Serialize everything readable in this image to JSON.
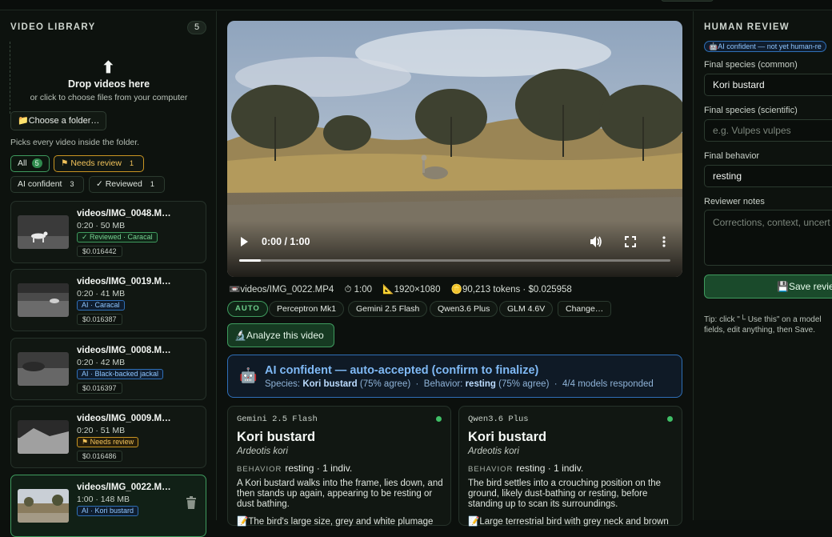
{
  "library": {
    "title": "VIDEO LIBRARY",
    "count": "5",
    "drop_title": "Drop videos here",
    "drop_sub": "or click to choose files from your computer",
    "choose_label": "📁Choose a folder…",
    "picks_note": "Picks every video inside the folder.",
    "filters": [
      {
        "label": "All",
        "count": "5"
      },
      {
        "label": "⚑ Needs review",
        "count": "1"
      },
      {
        "label": "AI confident",
        "count": "3"
      },
      {
        "label": "✓ Reviewed",
        "count": "1"
      }
    ],
    "videos": [
      {
        "name": "videos/IMG_0048.M…",
        "meta": "0:20 · 50 MB",
        "badge": "✓ Reviewed · Caracal",
        "badge_color": "green",
        "cost": "$0.016442"
      },
      {
        "name": "videos/IMG_0019.M…",
        "meta": "0:20 · 41 MB",
        "badge": "AI · Caracal",
        "badge_color": "blue",
        "cost": "$0.016387"
      },
      {
        "name": "videos/IMG_0008.M…",
        "meta": "0:20 · 42 MB",
        "badge": "AI · Black-backed jackal",
        "badge_color": "blue",
        "cost": "$0.016397"
      },
      {
        "name": "videos/IMG_0009.M…",
        "meta": "0:20 · 51 MB",
        "badge": "⚑ Needs review",
        "badge_color": "yellow",
        "cost": "$0.016486"
      },
      {
        "name": "videos/IMG_0022.M…",
        "meta": "1:00 · 148 MB",
        "badge": "AI · Kori bustard",
        "badge_color": "blue",
        "cost": ""
      }
    ]
  },
  "player": {
    "time": "0:00 / 1:00",
    "progress": 0.05
  },
  "meta": {
    "file": "📼videos/IMG_0022.MP4",
    "duration": "⏱ 1:00",
    "resolution": "📐1920×1080",
    "tokens": "🪙90,213 tokens · $0.025958"
  },
  "models": {
    "auto": "AUTO",
    "list": [
      "Perceptron Mk1",
      "Gemini 2.5 Flash",
      "Qwen3.6 Plus",
      "GLM 4.6V"
    ],
    "change": "Change…"
  },
  "analyze_label": "🔬Analyze this video",
  "verdict": {
    "icon": "🤖",
    "title": "AI confident — auto-accepted (confirm to finalize)",
    "species_label": "Species: ",
    "species": "Kori bustard",
    "species_agree": " (75% agree)",
    "sep1": "  ·  ",
    "behavior_label": "Behavior: ",
    "behavior": "resting",
    "behavior_agree": " (75% agree)",
    "sep2": "  ·  ",
    "responded": "4/4 models responded"
  },
  "model_cards": [
    {
      "model": "Gemini 2.5 Flash",
      "species": "Kori bustard",
      "scientific": "Ardeotis kori",
      "behavior_label": "BEHAVIOR",
      "behavior": "resting · 1 indiv.",
      "desc": "A Kori bustard walks into the frame, lies down, and then stands up again, appearing to be resting or dust bathing.",
      "note": "📝The bird's large size, grey and white plumage"
    },
    {
      "model": "Qwen3.6 Plus",
      "species": "Kori bustard",
      "scientific": "Ardeotis kori",
      "behavior_label": "BEHAVIOR",
      "behavior": "resting · 1 indiv.",
      "desc": "The bird settles into a crouching position on the ground, likely dust-bathing or resting, before standing up to scan its surroundings.",
      "note": "📝Large terrestrial bird with grey neck and brown"
    }
  ],
  "review": {
    "title": "HUMAN REVIEW",
    "badge": "🤖AI confident — not yet human-re",
    "species_common_label": "Final species (common)",
    "species_common_value": "Kori bustard",
    "species_sci_label": "Final species (scientific)",
    "species_sci_placeholder": "e.g. Vulpes vulpes",
    "behavior_label": "Final behavior",
    "behavior_value": "resting",
    "notes_label": "Reviewer notes",
    "notes_placeholder": "Corrections, context, uncert",
    "save_label": "💾Save revie",
    "tip": "Tip: click \"└ Use this\" on a model fields, edit anything, then Save."
  },
  "colors": {
    "accent_green": "#3f9b5e",
    "accent_blue": "#2f6fb7",
    "warn_yellow": "#c99522"
  }
}
